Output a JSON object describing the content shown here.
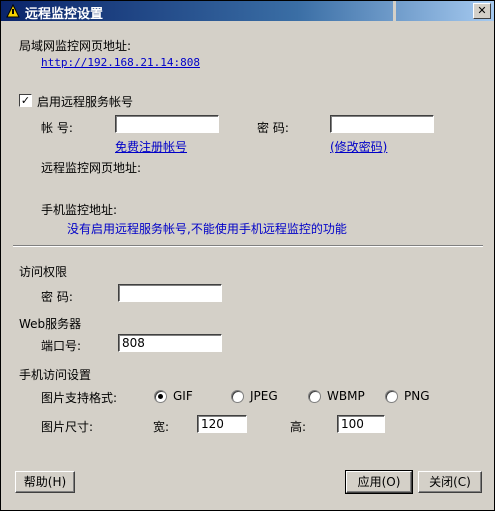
{
  "window": {
    "title": "远程监控设置",
    "close_glyph": "✕"
  },
  "lan": {
    "label": "局域网监控网页地址:",
    "url": "http://192.168.21.14:808"
  },
  "remote": {
    "enable_label": "启用远程服务帐号",
    "enabled": true,
    "check_glyph": "✓",
    "account_label": "帐 号:",
    "account_value": "",
    "password_label": "密 码:",
    "password_value": "",
    "register_link": "免费注册帐号",
    "change_pw_link": "(修改密码)",
    "web_addr_label": "远程监控网页地址:",
    "mobile_addr_label": "手机监控地址:",
    "notice": "没有启用远程服务帐号,不能使用手机远程监控的功能"
  },
  "access": {
    "section": "访问权限",
    "password_label": "密 码:",
    "password_value": ""
  },
  "web_server": {
    "section": "Web服务器",
    "port_label": "端口号:",
    "port_value": "808"
  },
  "mobile": {
    "section": "手机访问设置",
    "format_label": "图片支持格式:",
    "formats": [
      {
        "label": "GIF",
        "selected": true
      },
      {
        "label": "JPEG",
        "selected": false
      },
      {
        "label": "WBMP",
        "selected": false
      },
      {
        "label": "PNG",
        "selected": false
      }
    ],
    "size_label": "图片尺寸:",
    "width_label": "宽:",
    "width_value": "120",
    "height_label": "高:",
    "height_value": "100"
  },
  "buttons": {
    "help": "帮助(H)",
    "apply": "应用(O)",
    "close": "关闭(C)"
  }
}
